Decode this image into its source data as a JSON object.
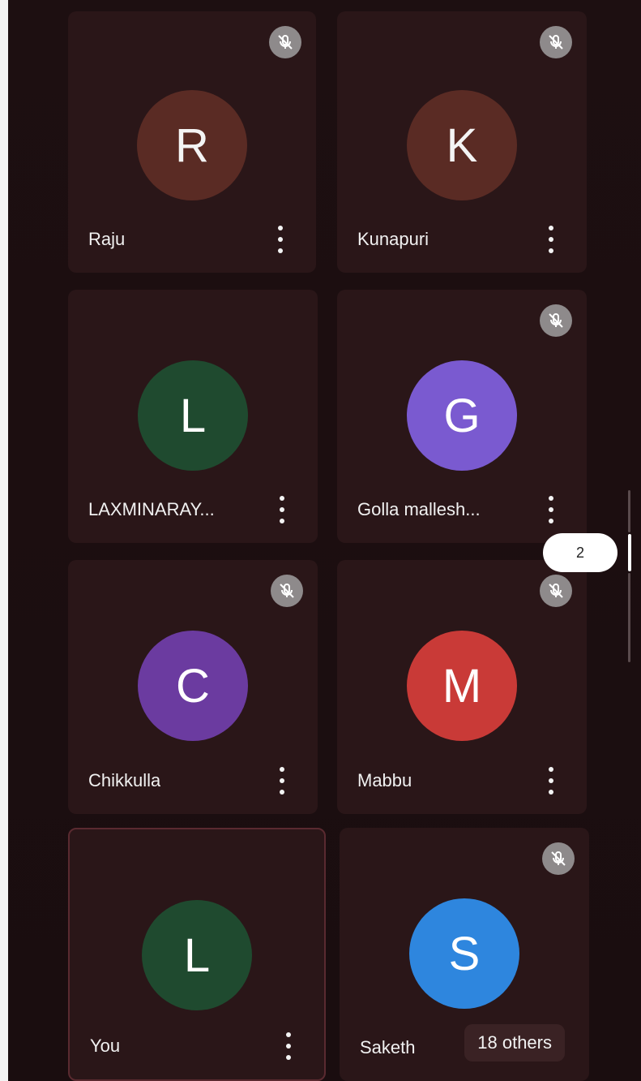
{
  "participants": [
    {
      "initial": "R",
      "name": "Raju",
      "avatar_color": "#5a2b24",
      "muted": true
    },
    {
      "initial": "K",
      "name": "Kunapuri",
      "avatar_color": "#5a2b24",
      "muted": true
    },
    {
      "initial": "L",
      "name": "LAXMINARAY...",
      "avatar_color": "#1f4a2f",
      "muted": false
    },
    {
      "initial": "G",
      "name": "Golla mallesh...",
      "avatar_color": "#7a5ad0",
      "muted": true
    },
    {
      "initial": "C",
      "name": "Chikkulla",
      "avatar_color": "#6b3ba0",
      "muted": true
    },
    {
      "initial": "M",
      "name": "Mabbu",
      "avatar_color": "#c93a37",
      "muted": true
    },
    {
      "initial": "L",
      "name": "You",
      "avatar_color": "#1f4a2f",
      "muted": false,
      "self": true
    },
    {
      "initial": "S",
      "name": "Saketh",
      "avatar_color": "#2e86de",
      "muted": true
    }
  ],
  "others_label": "18 others",
  "scroll": {
    "page_label": "2"
  },
  "icons": {
    "muted": "mic-off-icon",
    "more": "more-vert-icon"
  },
  "colors": {
    "background": "#1b0e10",
    "tile": "#2a1618",
    "mute_badge": "#8e8a8b",
    "text": "#f1f1f1"
  }
}
